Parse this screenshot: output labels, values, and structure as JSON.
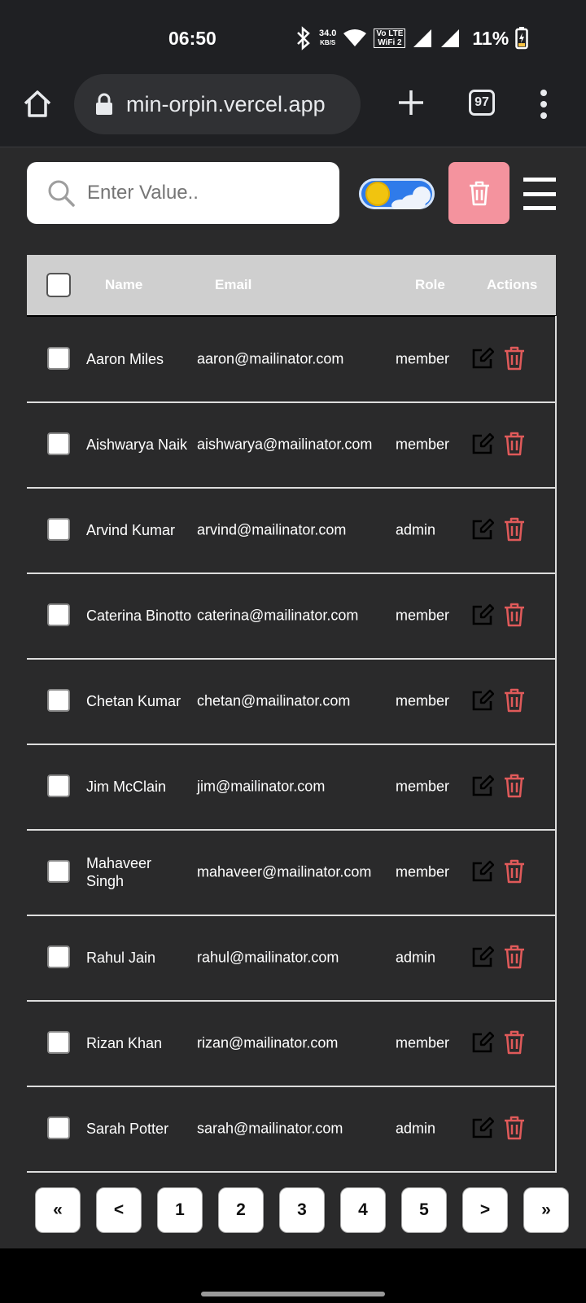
{
  "status": {
    "time": "06:50",
    "speed_value": "34.0",
    "speed_unit": "KB/S",
    "volte_top": "Vo LTE",
    "volte_bottom": "WiFi 2",
    "battery": "11%"
  },
  "browser": {
    "url": "min-orpin.vercel.app",
    "tab_count": "97"
  },
  "toolbar": {
    "search_placeholder": "Enter Value..",
    "theme_toggle_state": "light"
  },
  "table": {
    "columns": [
      "Name",
      "Email",
      "Role",
      "Actions"
    ],
    "rows": [
      {
        "name": "Aaron Miles",
        "email": "aaron@mailinator.com",
        "role": "member"
      },
      {
        "name": "Aishwarya Naik",
        "email": "aishwarya@mailinator.com",
        "role": "member"
      },
      {
        "name": "Arvind Kumar",
        "email": "arvind@mailinator.com",
        "role": "admin"
      },
      {
        "name": "Caterina Binotto",
        "email": "caterina@mailinator.com",
        "role": "member"
      },
      {
        "name": "Chetan Kumar",
        "email": "chetan@mailinator.com",
        "role": "member"
      },
      {
        "name": "Jim McClain",
        "email": "jim@mailinator.com",
        "role": "member"
      },
      {
        "name": "Mahaveer Singh",
        "email": "mahaveer@mailinator.com",
        "role": "member"
      },
      {
        "name": "Rahul Jain",
        "email": "rahul@mailinator.com",
        "role": "admin"
      },
      {
        "name": "Rizan Khan",
        "email": "rizan@mailinator.com",
        "role": "member"
      },
      {
        "name": "Sarah Potter",
        "email": "sarah@mailinator.com",
        "role": "admin"
      }
    ]
  },
  "pagination": {
    "first": "«",
    "prev": "<",
    "pages": [
      "1",
      "2",
      "3",
      "4",
      "5"
    ],
    "next": ">",
    "last": "»"
  },
  "colors": {
    "background": "#2a2a2b",
    "header": "#cfcfcf",
    "delete_accent": "#e05a5a",
    "bulk_delete_bg": "#f4939e"
  }
}
